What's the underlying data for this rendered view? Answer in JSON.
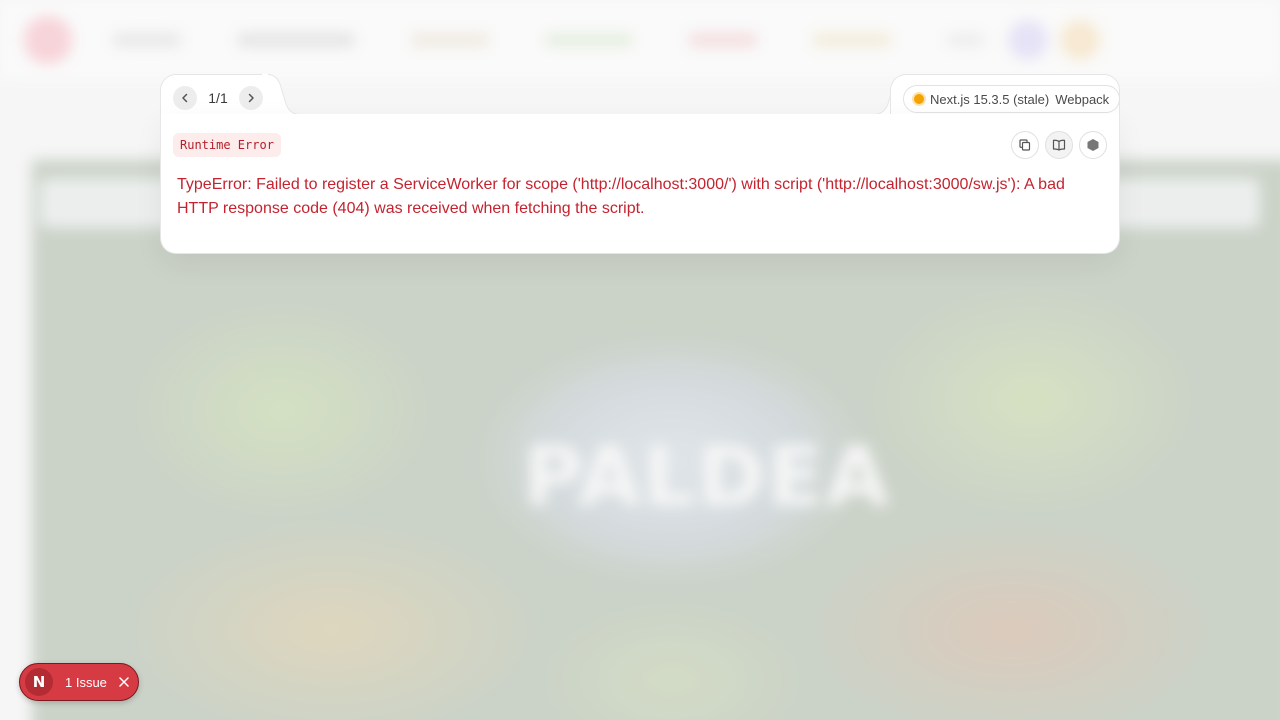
{
  "background_app": {
    "map_title": "PALDEA"
  },
  "error_overlay": {
    "pagination": {
      "text": "1/1"
    },
    "version": {
      "label": "Next.js 15.3.5 (stale)",
      "bundler": "Webpack",
      "status_color": "#f5a300"
    },
    "error_type": "Runtime Error",
    "error_message": "TypeError: Failed to register a ServiceWorker for scope ('http://localhost:3000/') with script ('http://localhost:3000/sw.js'): A bad HTTP response code (404) was received when fetching the script.",
    "actions": [
      {
        "name": "copy-stack",
        "icon": "copy-icon"
      },
      {
        "name": "docs",
        "icon": "book-icon"
      },
      {
        "name": "node-inspector",
        "icon": "node-icon"
      }
    ]
  },
  "issues_badge": {
    "logo": "N",
    "label": "1 Issue"
  },
  "colors": {
    "error_red": "#c4232f",
    "badge_red": "#d63a43",
    "badge_bg": "#fdecec"
  }
}
